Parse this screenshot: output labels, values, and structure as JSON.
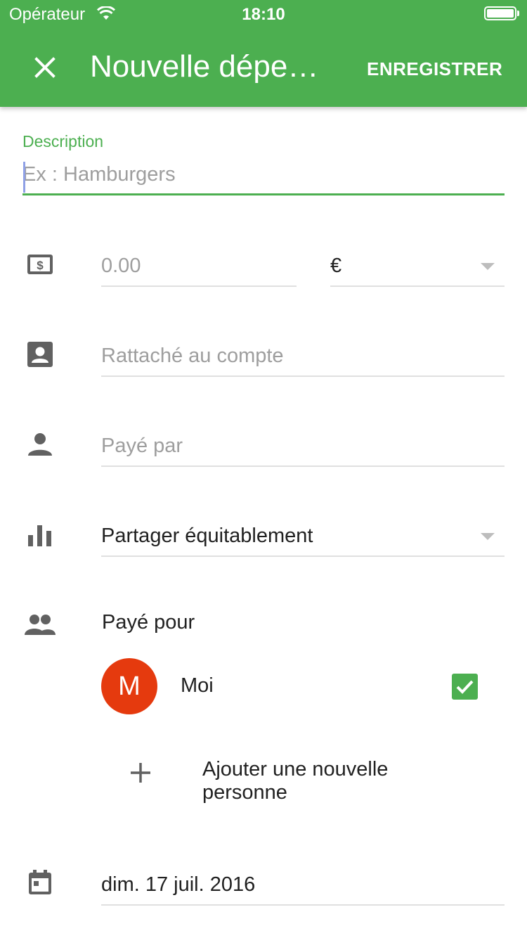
{
  "status_bar": {
    "carrier": "Opérateur",
    "time": "18:10"
  },
  "header": {
    "title": "Nouvelle dépe…",
    "save_label": "ENREGISTRER",
    "close_icon": "close-icon"
  },
  "description": {
    "label": "Description",
    "placeholder": "Ex : Hamburgers",
    "value": ""
  },
  "amount": {
    "placeholder": "0.00",
    "currency": "€"
  },
  "account": {
    "placeholder": "Rattaché au compte"
  },
  "paid_by": {
    "placeholder": "Payé par"
  },
  "split": {
    "value": "Partager équitablement"
  },
  "paid_for": {
    "label": "Payé pour",
    "people": [
      {
        "initial": "M",
        "name": "Moi",
        "checked": true
      }
    ],
    "add_label": "Ajouter une nouvelle personne"
  },
  "date": {
    "value": "dim. 17 juil. 2016"
  },
  "colors": {
    "accent": "#4caf50",
    "avatar": "#e53a0e",
    "icon": "#616161"
  }
}
